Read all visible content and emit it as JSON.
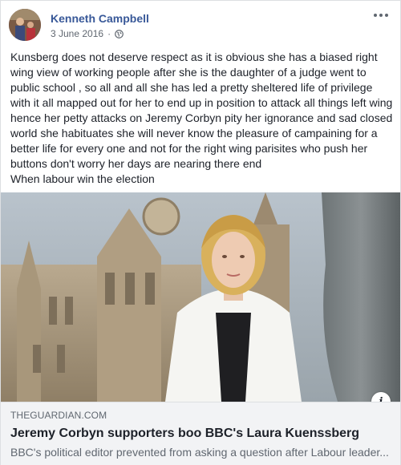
{
  "post": {
    "author": "Kenneth Campbell",
    "date": "3 June 2016",
    "privacy_icon": "globe-icon",
    "more_icon": "more-options-icon",
    "text": "Kunsberg does not deserve respect as it is obvious she has a biased right wing view of working people after she is the daughter of a judge went to public school , so all and all she has led a pretty sheltered life of privilege with it all mapped out for her to end up in position to attack all things left wing hence her petty attacks on Jeremy Corbyn pity her ignorance and sad closed world she habituates she will never know the pleasure of campaining for a better life for every one and not for the right wing parisites who push her buttons don't worry her days are nearing there end\nWhen labour win the election"
  },
  "link": {
    "domain": "THEGUARDIAN.COM",
    "title": "Jeremy Corbyn supporters boo BBC's Laura Kuenssberg",
    "description": "BBC's political editor prevented from asking a question after Labour leader...",
    "info_label": "i"
  },
  "colors": {
    "author": "#385898",
    "meta": "#606770",
    "link_bg": "#f2f3f5"
  }
}
